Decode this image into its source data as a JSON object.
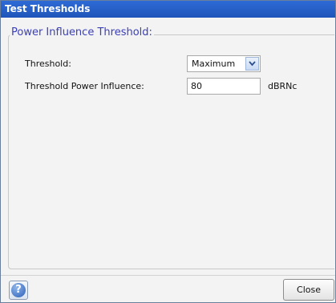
{
  "window": {
    "title": "Test Thresholds"
  },
  "group": {
    "legend": "Power Influence Threshold:"
  },
  "threshold": {
    "label": "Threshold:",
    "selected": "Maximum"
  },
  "power_influence": {
    "label": "Threshold Power Influence:",
    "value": "80",
    "unit": "dBRNc"
  },
  "footer": {
    "help_glyph": "?",
    "close_label": "Close"
  },
  "colors": {
    "titlebar": "#1f55b9",
    "legend_text": "#3b3fb8"
  }
}
